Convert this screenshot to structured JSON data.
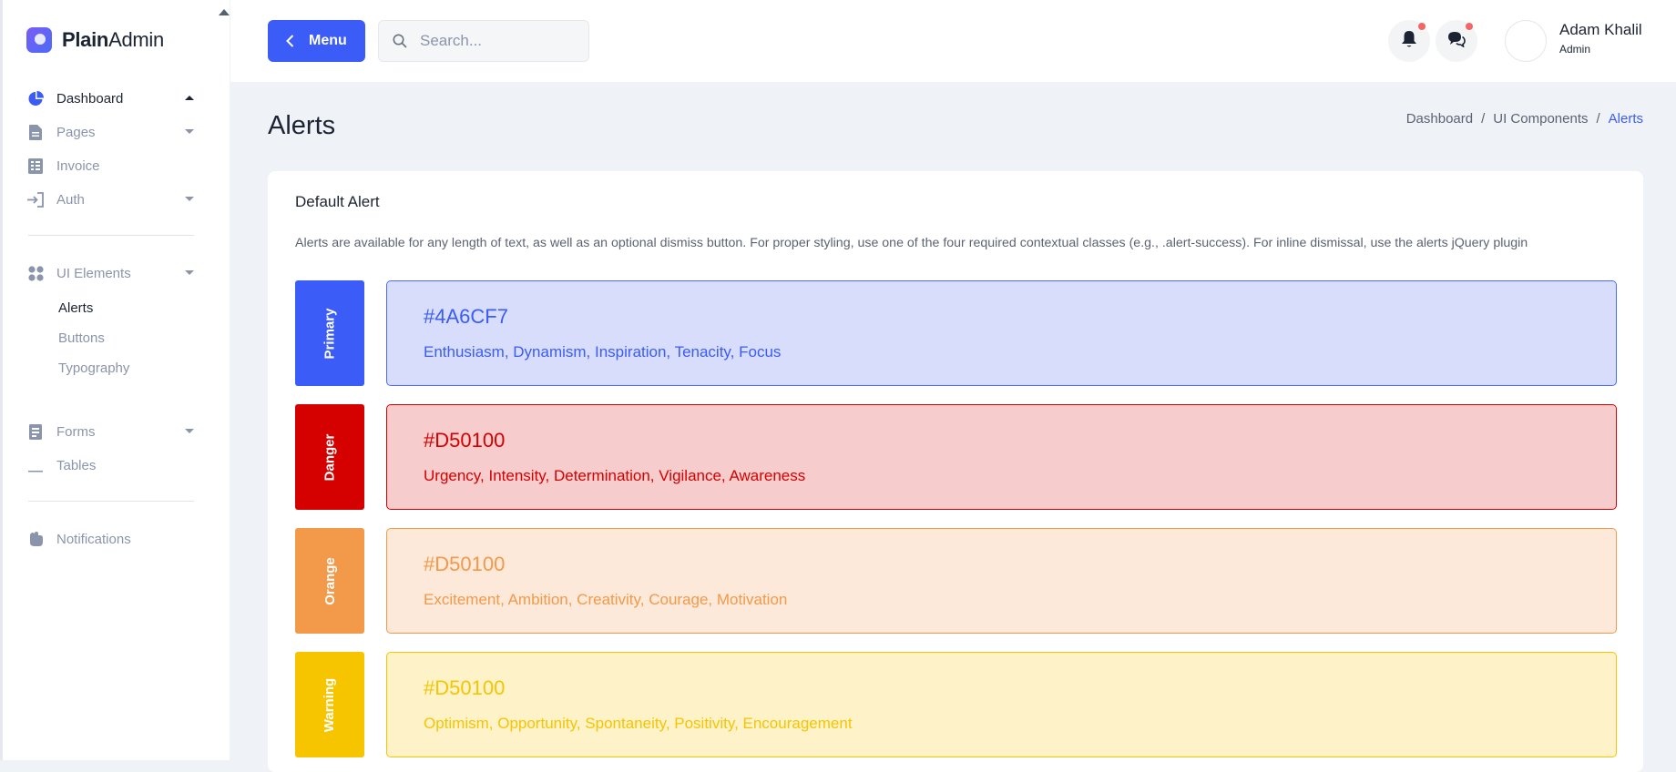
{
  "brand": {
    "name_bold": "Plain",
    "name_rest": "Admin"
  },
  "sidebar": {
    "items": [
      {
        "label": "Dashboard",
        "icon": "pie-chart-icon",
        "active": true
      },
      {
        "label": "Pages",
        "icon": "document-icon"
      },
      {
        "label": "Invoice",
        "icon": "invoice-icon"
      },
      {
        "label": "Auth",
        "icon": "login-icon"
      },
      {
        "label": "UI Elements",
        "icon": "grid-icon"
      },
      {
        "label": "Forms",
        "icon": "form-icon"
      },
      {
        "label": "Tables",
        "icon": "table-icon"
      },
      {
        "label": "Notifications",
        "icon": "bell-hand-icon"
      }
    ],
    "ui_sub": [
      "Alerts",
      "Buttons",
      "Typography"
    ]
  },
  "header": {
    "menu_label": "Menu",
    "search_placeholder": "Search...",
    "user_name": "Adam Khalil",
    "user_role": "Admin"
  },
  "page": {
    "title": "Alerts",
    "breadcrumb": [
      "Dashboard",
      "UI Components",
      "Alerts"
    ]
  },
  "card": {
    "title": "Default Alert",
    "description": "Alerts are available for any length of text, as well as an optional dismiss button. For proper styling, use one of the four required contextual classes (e.g., .alert-success). For inline dismissal, use the alerts jQuery plugin"
  },
  "alerts": [
    {
      "tag": "Primary",
      "hex": "#4A6CF7",
      "words": "Enthusiasm, Dynamism, Inspiration, Tenacity, Focus",
      "tag_color": "#3b5cf6",
      "bg": "#d7ddfb",
      "border": "#4a6cf7",
      "text": "#3b5cf6"
    },
    {
      "tag": "Danger",
      "hex": "#D50100",
      "words": "Urgency, Intensity, Determination, Vigilance, Awareness",
      "tag_color": "#d50100",
      "bg": "#f6cccc",
      "border": "#d50100",
      "text": "#d50100"
    },
    {
      "tag": "Orange",
      "hex": "#D50100",
      "words": "Excitement, Ambition, Creativity, Courage, Motivation",
      "tag_color": "#f2994a",
      "bg": "#fde9d9",
      "border": "#f2994a",
      "text": "#f2994a"
    },
    {
      "tag": "Warning",
      "hex": "#D50100",
      "words": "Optimism, Opportunity, Spontaneity, Positivity, Encouragement",
      "tag_color": "#f6c500",
      "bg": "#fdf2c8",
      "border": "#f6c500",
      "text": "#f6c500"
    }
  ]
}
